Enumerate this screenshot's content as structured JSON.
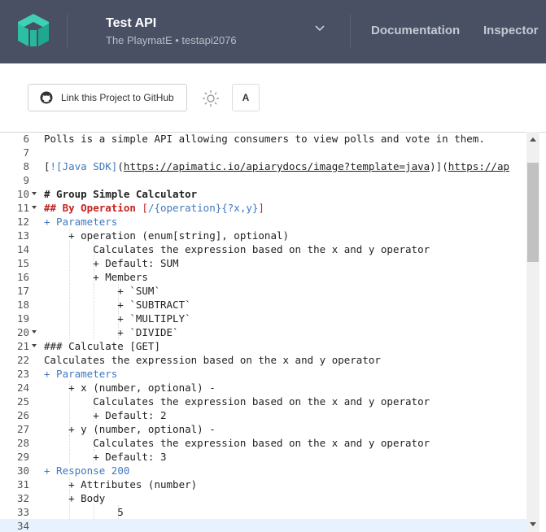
{
  "header": {
    "title": "Test API",
    "subtitle": "The PlaymatE • testapi2076",
    "nav": [
      "Documentation",
      "Inspector"
    ],
    "bg_color": "#4a5064",
    "logo_color": "#2bc0a4"
  },
  "toolbar": {
    "github_label": "Link this Project to GitHub",
    "font_button": "A"
  },
  "editor": {
    "lines": [
      {
        "n": "6",
        "fold": false,
        "text": "Polls is a simple API allowing consumers to view polls and vote in them."
      },
      {
        "n": "7",
        "fold": false,
        "text": ""
      },
      {
        "n": "8",
        "fold": false,
        "text": "[![Java SDK](https://apimatic.io/apiarydocs/image?template=java)](https://ap"
      },
      {
        "n": "9",
        "fold": false,
        "text": ""
      },
      {
        "n": "10",
        "fold": true,
        "text": "# Group Simple Calculator"
      },
      {
        "n": "11",
        "fold": true,
        "text": "## By Operation [/{operation}{?x,y}]"
      },
      {
        "n": "12",
        "fold": false,
        "text": "+ Parameters"
      },
      {
        "n": "13",
        "fold": false,
        "text": "    + operation (enum[string], optional)"
      },
      {
        "n": "14",
        "fold": false,
        "text": "        Calculates the expression based on the x and y operator"
      },
      {
        "n": "15",
        "fold": false,
        "text": "        + Default: SUM"
      },
      {
        "n": "16",
        "fold": false,
        "text": "        + Members"
      },
      {
        "n": "17",
        "fold": false,
        "text": "            + `SUM`"
      },
      {
        "n": "18",
        "fold": false,
        "text": "            + `SUBTRACT`"
      },
      {
        "n": "19",
        "fold": false,
        "text": "            + `MULTIPLY`"
      },
      {
        "n": "20",
        "fold": true,
        "text": "            + `DIVIDE`"
      },
      {
        "n": "21",
        "fold": true,
        "text": "### Calculate [GET]"
      },
      {
        "n": "22",
        "fold": false,
        "text": "Calculates the expression based on the x and y operator"
      },
      {
        "n": "23",
        "fold": false,
        "text": "+ Parameters"
      },
      {
        "n": "24",
        "fold": false,
        "text": "    + x (number, optional) -"
      },
      {
        "n": "25",
        "fold": false,
        "text": "        Calculates the expression based on the x and y operator"
      },
      {
        "n": "26",
        "fold": false,
        "text": "        + Default: 2"
      },
      {
        "n": "27",
        "fold": false,
        "text": "    + y (number, optional) -"
      },
      {
        "n": "28",
        "fold": false,
        "text": "        Calculates the expression based on the x and y operator"
      },
      {
        "n": "29",
        "fold": false,
        "text": "        + Default: 3"
      },
      {
        "n": "30",
        "fold": false,
        "text": "+ Response 200"
      },
      {
        "n": "31",
        "fold": false,
        "text": "    + Attributes (number)"
      },
      {
        "n": "32",
        "fold": false,
        "text": "    + Body"
      },
      {
        "n": "33",
        "fold": false,
        "text": "            5"
      },
      {
        "n": "34",
        "fold": false,
        "text": ""
      }
    ]
  }
}
